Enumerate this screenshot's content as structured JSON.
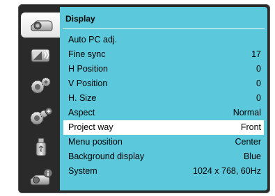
{
  "menu": {
    "title": "Display",
    "items": [
      {
        "label": "Auto PC adj.",
        "value": ""
      },
      {
        "label": "Fine sync",
        "value": "17"
      },
      {
        "label": "H Position",
        "value": "0"
      },
      {
        "label": "V Position",
        "value": "0"
      },
      {
        "label": "H. Size",
        "value": "0"
      },
      {
        "label": "Aspect",
        "value": "Normal"
      },
      {
        "label": "Project way",
        "value": "Front"
      },
      {
        "label": "Menu position",
        "value": "Center"
      },
      {
        "label": "Background display",
        "value": "Blue"
      },
      {
        "label": "System",
        "value": "1024 x 768, 60Hz"
      }
    ],
    "selected_index": 6
  },
  "sidebar": {
    "items": [
      {
        "icon": "display-icon",
        "active": true
      },
      {
        "icon": "image-adjust-icon",
        "active": false
      },
      {
        "icon": "setting-gear-icon",
        "active": false
      },
      {
        "icon": "expanded-setting-icon",
        "active": false
      },
      {
        "icon": "usb-memory-icon",
        "active": false
      },
      {
        "icon": "information-icon",
        "active": false
      }
    ]
  },
  "colors": {
    "panel_bg": "#5bc8dc",
    "frame_bg": "#2a2a2a",
    "highlight_bg": "#ffffff"
  }
}
